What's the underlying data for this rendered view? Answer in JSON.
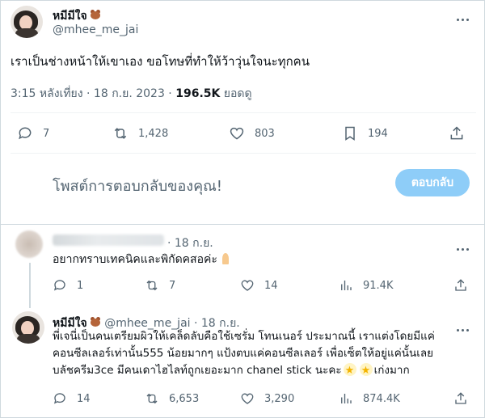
{
  "main_tweet": {
    "display_name": "หมีมีใจ",
    "handle": "@mhee_me_jai",
    "text": "เราเป็นช่างหน้าให้เขาเอง ขอโทษที่ทำให้ว้าวุ่นใจนะทุกคน",
    "time": "3:15 หลังเที่ยง · 18 ก.ย. 2023 · ",
    "views": "196.5K",
    "views_label": " ยอดดู",
    "replies": "7",
    "retweets": "1,428",
    "likes": "803",
    "bookmarks": "194"
  },
  "compose": {
    "placeholder": "โพสต์การตอบกลับของคุณ!",
    "reply_button": "ตอบกลับ"
  },
  "reply1": {
    "date": "· 18 ก.ย.",
    "text": "อยากทราบเทคนิคและพิกัดคสอค่ะ",
    "replies": "1",
    "retweets": "7",
    "likes": "14",
    "views": "91.4K"
  },
  "reply2": {
    "display_name": "หมีมีใจ",
    "handle": "@mhee_me_jai",
    "date": "· 18 ก.ย.",
    "line1": "พี่เจนี่เป็นคนเตรียมผิวให้เคล็ดลับคือใช้เซรั่ม โทนเนอร์ ประมาณนี้ เราแต่งโดยมีแค่",
    "line2": "คอนซีลเลอร์เท่านั้น555 น้อยมากๆ แป้งตบแค่คอนซีลเลอร์ เพื่อเซ็ตให้อยู่แค่นั้นเลย",
    "line3a": "บลัชครีม3ce มีคนเดาไฮไลท์ถูกเยอะมาก chanel stick นะคะ",
    "line3b": "เก่งมาก",
    "replies": "14",
    "retweets": "6,653",
    "likes": "3,290",
    "views": "874.4K"
  }
}
